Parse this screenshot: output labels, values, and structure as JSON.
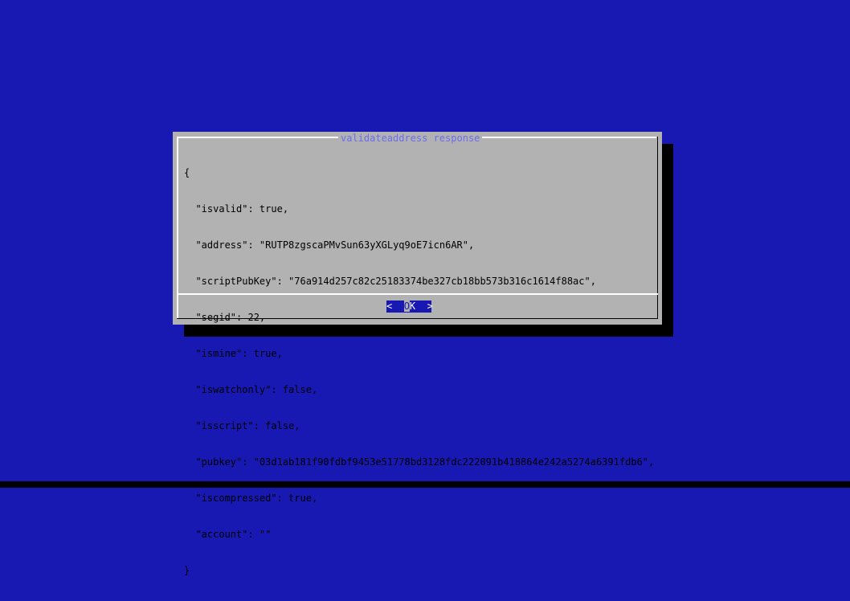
{
  "dialog": {
    "title": "validateaddress response",
    "lines": [
      "{",
      "  \"isvalid\": true,",
      "  \"address\": \"RUTP8zgscaPMvSun63yXGLyq9oE7icn6AR\",",
      "  \"scriptPubKey\": \"76a914d257c82c25183374be327cb18bb573b316c1614f88ac\",",
      "  \"segid\": 22,",
      "  \"ismine\": true,",
      "  \"iswatchonly\": false,",
      "  \"isscript\": false,",
      "  \"pubkey\": \"03d1ab181f90fdbf9453e51778bd3128fdc222091b418864e242a5274a6391fdb6\",",
      "  \"iscompressed\": true,",
      "  \"account\": \"\"",
      "}"
    ],
    "ok_button": {
      "left": "<  ",
      "cursor_char": "O",
      "rest": "K  >"
    }
  },
  "colors": {
    "background": "#1818b2",
    "dialog": "#b2b2b2",
    "title": "#6b6bf0",
    "button_bg": "#1818b2",
    "button_fg": "#ffffff"
  }
}
